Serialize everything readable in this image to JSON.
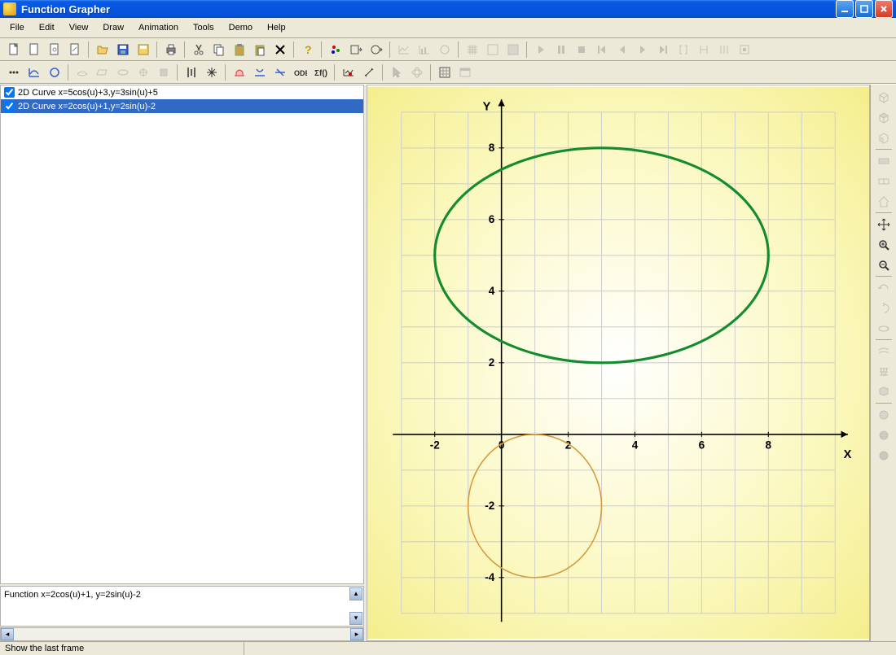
{
  "window": {
    "title": "Function Grapher"
  },
  "menu": {
    "items": [
      "File",
      "Edit",
      "View",
      "Draw",
      "Animation",
      "Tools",
      "Demo",
      "Help"
    ]
  },
  "curves": [
    {
      "checked": true,
      "label": "2D Curve  x=5cos(u)+3,y=3sin(u)+5",
      "selected": false
    },
    {
      "checked": true,
      "label": "2D Curve  x=2cos(u)+1,y=2sin(u)-2",
      "selected": true
    }
  ],
  "info": {
    "text": "Function x=2cos(u)+1, y=2sin(u)-2"
  },
  "status": {
    "text": "Show the last frame"
  },
  "chart_data": {
    "type": "line",
    "xlabel": "X",
    "ylabel": "Y",
    "xlim": [
      -3,
      10
    ],
    "ylim": [
      -5,
      9
    ],
    "xticks": [
      -2,
      0,
      2,
      4,
      6,
      8
    ],
    "yticks": [
      -4,
      -2,
      2,
      4,
      6,
      8
    ],
    "series": [
      {
        "name": "2D Curve x=5cos(u)+3,y=3sin(u)+5",
        "color": "#148b2e",
        "type": "ellipse",
        "cx": 3,
        "cy": 5,
        "rx": 5,
        "ry": 3,
        "strokeWidth": 3
      },
      {
        "name": "2D Curve x=2cos(u)+1,y=2sin(u)-2",
        "color": "#d99a3e",
        "type": "ellipse",
        "cx": 1,
        "cy": -2,
        "rx": 2,
        "ry": 2,
        "strokeWidth": 1.5
      }
    ]
  }
}
